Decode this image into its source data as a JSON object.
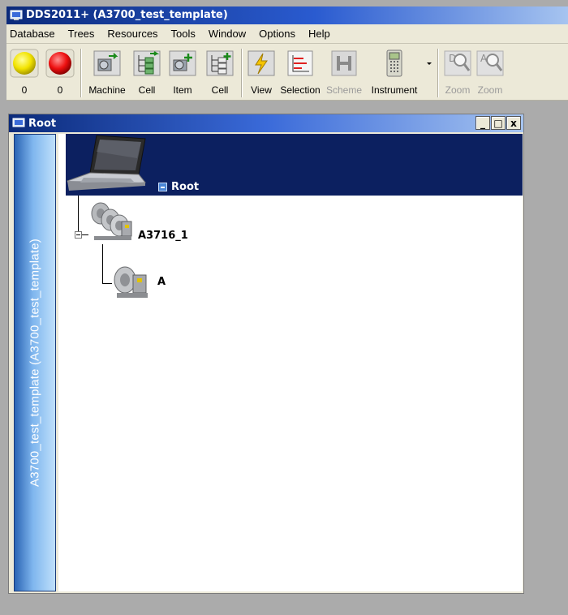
{
  "app": {
    "title": "DDS2011+ (A3700_test_template)"
  },
  "menu": [
    {
      "label": "Database"
    },
    {
      "label": "Trees"
    },
    {
      "label": "Resources"
    },
    {
      "label": "Tools"
    },
    {
      "label": "Window"
    },
    {
      "label": "Options"
    },
    {
      "label": "Help"
    }
  ],
  "toolbar": {
    "buttons": [
      {
        "label": "0",
        "icon": "yellow-circle-icon"
      },
      {
        "label": "0",
        "icon": "red-circle-icon"
      },
      {
        "label": "Machine",
        "icon": "machine-icon"
      },
      {
        "label": "Cell",
        "icon": "cell-tree-icon"
      },
      {
        "label": "Item",
        "icon": "item-icon"
      },
      {
        "label": "Cell",
        "icon": "cell-add-icon"
      },
      {
        "label": "View",
        "icon": "lightning-icon"
      },
      {
        "label": "Selection",
        "icon": "selection-chart-icon"
      },
      {
        "label": "Scheme",
        "icon": "scheme-icon",
        "disabled": true
      },
      {
        "label": "Instrument",
        "icon": "instrument-icon"
      },
      {
        "label": "Zoom",
        "icon": "zoom-in-icon",
        "disabled": true
      },
      {
        "label": "Zoom",
        "icon": "zoom-out-icon",
        "disabled": true
      }
    ]
  },
  "root_window": {
    "title": "Root",
    "controls": [
      "_",
      "□",
      "x"
    ],
    "side_label": "A3700_test_template (A3700_test_template)",
    "root_node": "Root",
    "nodes": [
      {
        "label": "A3716_1"
      },
      {
        "label": "A"
      }
    ]
  }
}
